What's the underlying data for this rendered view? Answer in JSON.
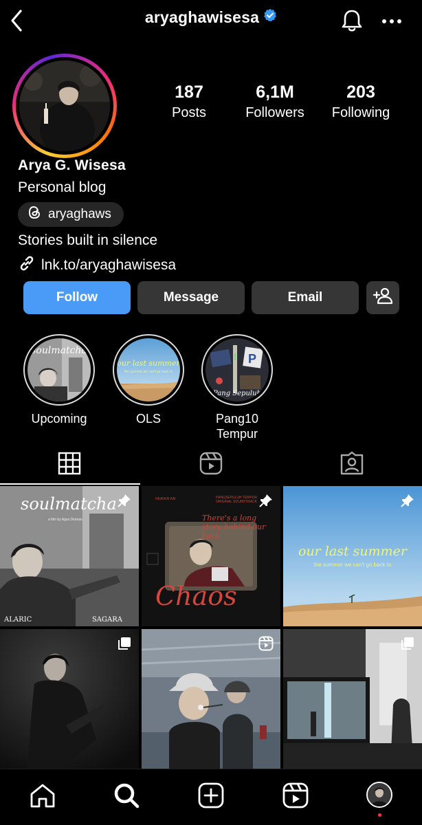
{
  "header": {
    "username": "aryaghawisesa",
    "verified": true,
    "icons": [
      "back-icon",
      "verified-badge-icon",
      "bell-icon",
      "more-icon"
    ]
  },
  "profile": {
    "stats": [
      {
        "value": "187",
        "label": "Posts"
      },
      {
        "value": "6,1M",
        "label": "Followers"
      },
      {
        "value": "203",
        "label": "Following"
      }
    ],
    "name": "Arya G. Wisesa",
    "category": "Personal blog",
    "threads_handle": "aryaghaws",
    "bio": "Stories built in silence",
    "link": "lnk.to/aryaghawisesa"
  },
  "actions": {
    "follow": "Follow",
    "message": "Message",
    "email": "Email"
  },
  "highlights": [
    {
      "label": "Upcoming",
      "cover_text": "soulmatcha"
    },
    {
      "label": "OLS",
      "cover_text": "our last summer",
      "cover_subtext": "the summer we can't go back to"
    },
    {
      "label": "Pang10\nTempur",
      "cover_text": "Pang Sepuluh"
    }
  ],
  "tabs": [
    "grid-icon",
    "reels-icon",
    "tagged-icon"
  ],
  "posts": [
    {
      "title": "soulmatcha",
      "credit": "a film by Agus Dinman",
      "names": [
        "ALARIC",
        "SAGARA"
      ],
      "pinned": true
    },
    {
      "label_left": "HEAVEN KAI",
      "label_right": "PANGSEPULUH TEMPUR ORIGINAL SOUNDTRACK",
      "lyric": "There's a long story behind our back",
      "title": "Chaos",
      "pinned": true
    },
    {
      "title": "our last summer",
      "subtitle": "the summer we can't go back to",
      "pinned": true
    },
    {
      "type": "carousel"
    },
    {
      "type": "reel"
    },
    {
      "type": "carousel"
    }
  ],
  "bottom_nav": [
    "home-icon",
    "search-icon",
    "create-icon",
    "reels-nav-icon",
    "profile-avatar"
  ],
  "colors": {
    "background": "#000000",
    "follow_button": "#4a9af7",
    "secondary_button": "#363636",
    "verified": "#3897f0"
  }
}
